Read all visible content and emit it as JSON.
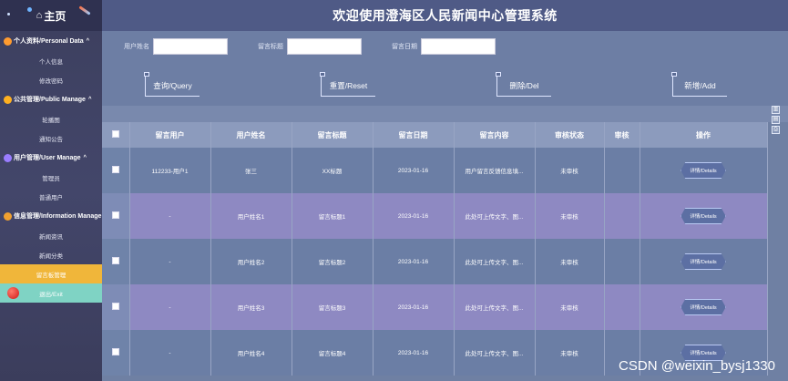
{
  "sidebar": {
    "home_label": "主页",
    "groups": [
      {
        "label": "个人资料/Personal Data",
        "icon": "person-icon",
        "items": [
          "个人信息",
          "修改密码"
        ]
      },
      {
        "label": "公共管理/Public Manage",
        "icon": "globe-icon",
        "items": [
          "轮播图",
          "通知公告"
        ]
      },
      {
        "label": "用户管理/User Manage",
        "icon": "users-icon",
        "items": [
          "管理员",
          "普通用户"
        ]
      },
      {
        "label": "信息管理/Information Manage",
        "icon": "info-icon",
        "items": [
          "新闻资讯",
          "新闻分类",
          "留言板管理"
        ]
      }
    ],
    "exit_label": "退出/Exit",
    "active_item": "留言板管理"
  },
  "header": {
    "title": "欢迎使用澄海区人民新闻中心管理系统"
  },
  "search": {
    "fields": [
      {
        "label": "用户姓名",
        "value": ""
      },
      {
        "label": "留言标题",
        "value": ""
      },
      {
        "label": "留言日期",
        "value": ""
      }
    ]
  },
  "buttons": {
    "query": "查询/Query",
    "reset": "重置/Reset",
    "delete": "删除/Del",
    "add": "新增/Add"
  },
  "table": {
    "columns": [
      "留言用户",
      "用户姓名",
      "留言标题",
      "留言日期",
      "留言内容",
      "审核状态",
      "审核",
      "操作"
    ],
    "detail_label": "详情/Details",
    "rows": [
      {
        "user": "112233-用户1",
        "name": "张三",
        "title": "XX标题",
        "date": "2023-01-16",
        "content": "用户留言反馈信息填...",
        "status": "未审核"
      },
      {
        "user": "-",
        "name": "用户姓名1",
        "title": "留言标题1",
        "date": "2023-01-16",
        "content": "此处可上传文字、图...",
        "status": "未审核"
      },
      {
        "user": "-",
        "name": "用户姓名2",
        "title": "留言标题2",
        "date": "2023-01-16",
        "content": "此处可上传文字、图...",
        "status": "未审核"
      },
      {
        "user": "-",
        "name": "用户姓名3",
        "title": "留言标题3",
        "date": "2023-01-16",
        "content": "此处可上传文字、图...",
        "status": "未审核"
      },
      {
        "user": "-",
        "name": "用户姓名4",
        "title": "留言标题4",
        "date": "2023-01-16",
        "content": "此处可上传文字、图...",
        "status": "未审核"
      }
    ]
  },
  "watermark": "CSDN @weixin_bysj1330",
  "colors": {
    "sidebar": "#3c3f5e",
    "header": "#4f5a86",
    "active": "#f0b63a",
    "exit": "#7fd3c4"
  }
}
